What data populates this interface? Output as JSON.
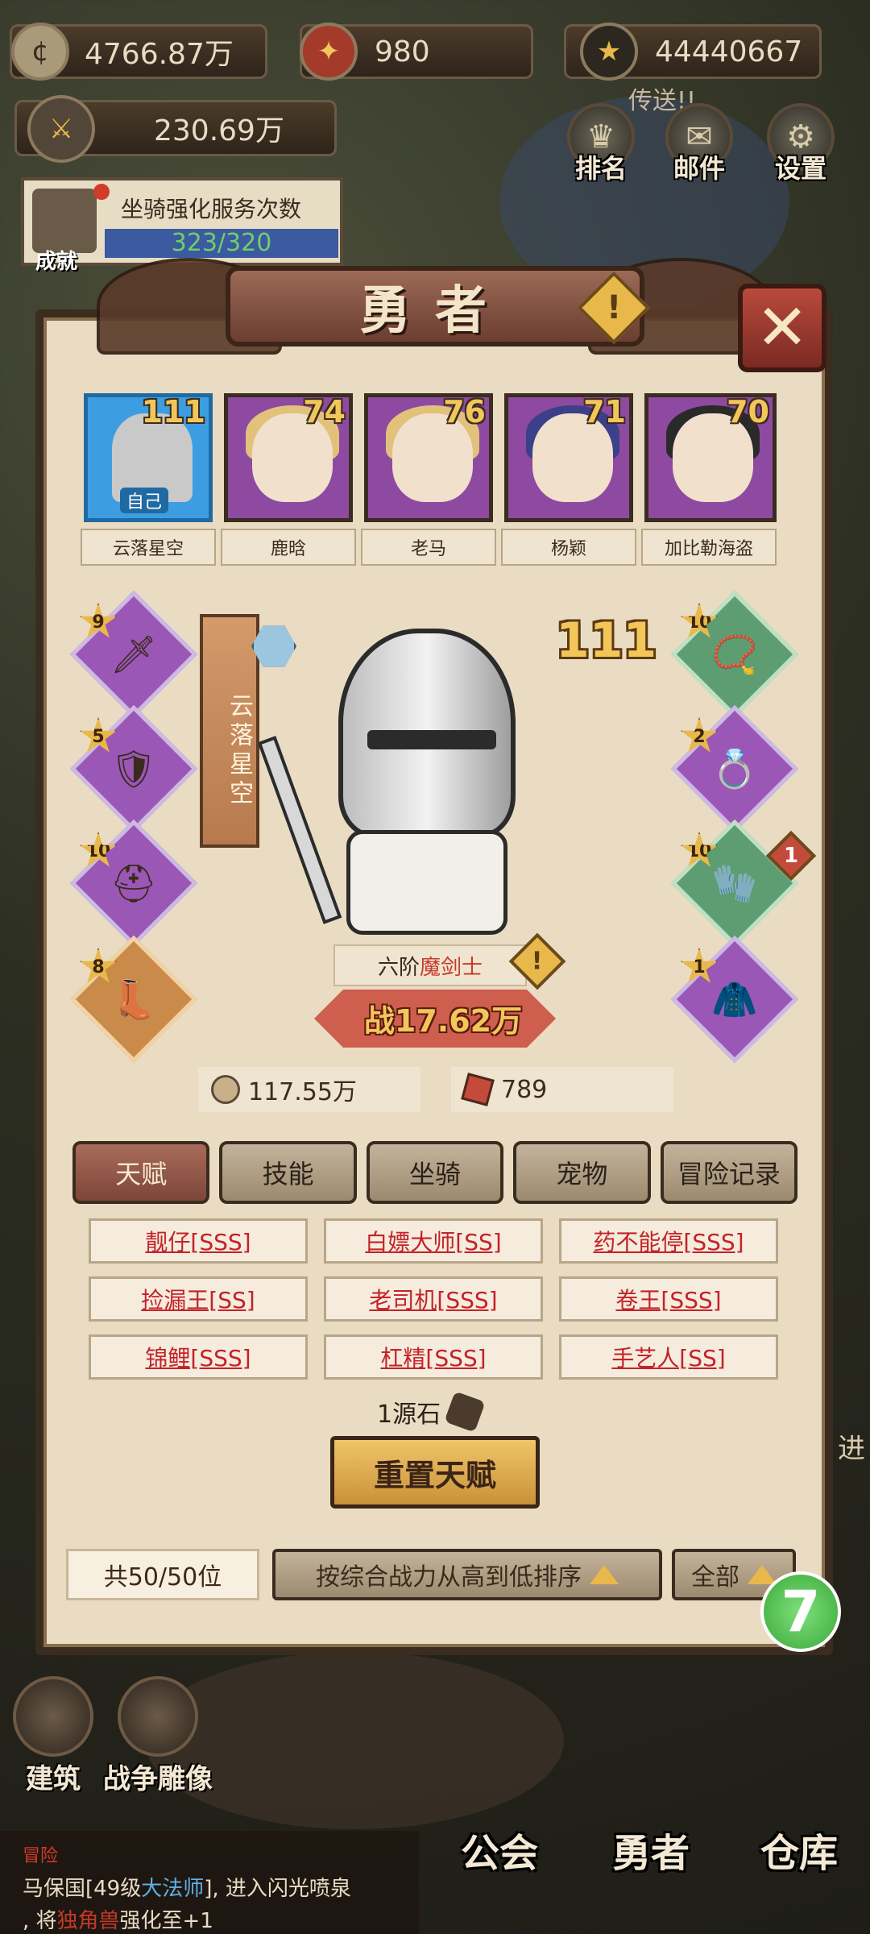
{
  "top": {
    "gold": "4766.87万",
    "crest": "980",
    "stars": "44440667",
    "power_total": "230.69万",
    "portal": "传送!!",
    "mount_service_label": "坐骑强化服务次数",
    "mount_service_count": "323/320",
    "achievement": "成就",
    "rank": "排名",
    "mail": "邮件",
    "settings": "设置"
  },
  "panel": {
    "title": "勇者",
    "heroes": [
      {
        "name": "云落星空",
        "level": "111",
        "tag": "自己"
      },
      {
        "name": "鹿晗",
        "level": "74"
      },
      {
        "name": "老马",
        "level": "76"
      },
      {
        "name": "杨颖",
        "level": "71"
      },
      {
        "name": "加比勒海盗",
        "level": "70"
      }
    ],
    "selected": {
      "name": "云落星空",
      "level": "111",
      "class_prefix": "六阶",
      "class": "魔剑士",
      "power": "战17.62万",
      "gold": "117.55万",
      "gems": "789"
    },
    "equipment_left": [
      "9",
      "5",
      "10",
      "8"
    ],
    "equipment_right": [
      "10",
      "2",
      "10",
      "1"
    ],
    "equipment_right_badge": "1",
    "tabs": [
      "天赋",
      "技能",
      "坐骑",
      "宠物",
      "冒险记录"
    ],
    "talents": [
      "靓仔[SSS]",
      "白嫖大师[SS]",
      "药不能停[SSS]",
      "捡漏王[SS]",
      "老司机[SSS]",
      "卷王[SSS]",
      "锦鲤[SSS]",
      "杠精[SSS]",
      "手艺人[SS]"
    ],
    "stone_cost": "1源石",
    "reset_label": "重置天赋",
    "count": "共50/50位",
    "sort_label": "按综合战力从高到低排序",
    "filter_label": "全部"
  },
  "bottom": {
    "build": "建筑",
    "statue": "战争雕像",
    "guild": "公会",
    "heroes": "勇者",
    "warehouse": "仓库",
    "news_title": "冒险",
    "news_line1_a": "马保国[49级",
    "news_line1_b": "大法师",
    "news_line1_c": "], 进入闪光喷泉",
    "news_line2_a": ", 将",
    "news_line2_b": "独角兽",
    "news_line2_c": "强化至+1",
    "side_text": "进"
  }
}
